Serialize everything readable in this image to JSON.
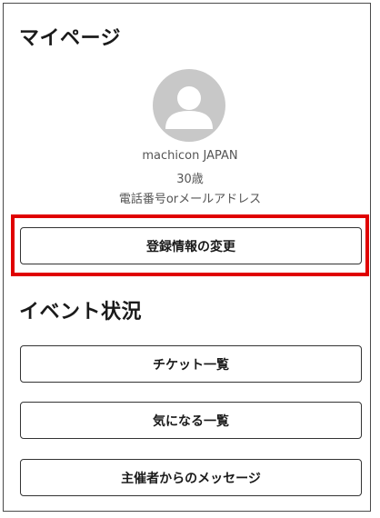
{
  "mypage": {
    "title": "マイページ",
    "avatar_icon": "user-avatar-icon",
    "user": {
      "name": "machicon JAPAN",
      "age": "30歳",
      "contact": "電話番号orメールアドレス"
    },
    "edit_button_label": "登録情報の変更"
  },
  "events": {
    "title": "イベント状況",
    "buttons": [
      {
        "label": "チケット一覧"
      },
      {
        "label": "気になる一覧"
      },
      {
        "label": "主催者からのメッセージ"
      }
    ]
  },
  "colors": {
    "highlight": "#e00000",
    "avatar": "#c8c8c8",
    "border": "#333333"
  }
}
